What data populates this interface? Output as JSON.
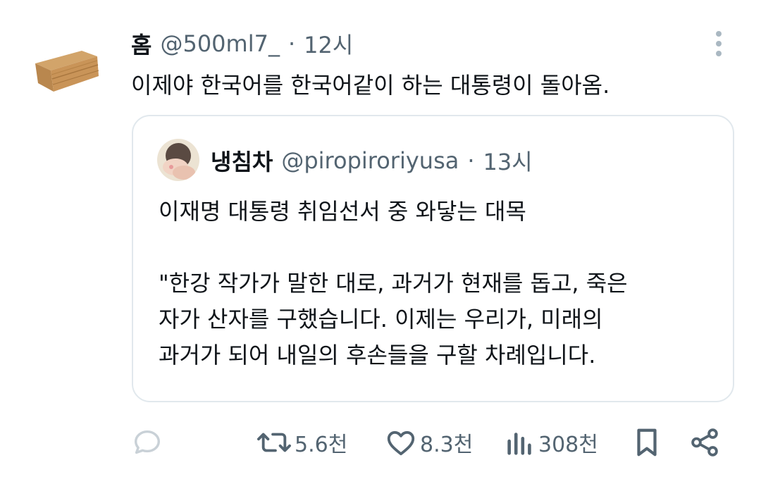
{
  "tweet": {
    "author_name": "홈",
    "handle": "@500ml7_",
    "separator": "·",
    "time": "12시",
    "text": "이제야 한국어를 한국어같이 하는 대통령이 돌아옴."
  },
  "quote": {
    "author_name": "냉침차",
    "handle": "@piropiroriyusa",
    "separator": "·",
    "time": "13시",
    "text": "이재명 대통령 취임선서 중 와닿는 대목\n\n\"한강 작가가 말한 대로, 과거가 현재를 돕고, 죽은\n자가 산자를 구했습니다. 이제는 우리가, 미래의\n과거가 되어 내일의 후손들을 구할 차례입니다."
  },
  "actions": {
    "retweets": "5.6천",
    "likes": "8.3천",
    "views": "308천"
  },
  "icons": {
    "reply": "reply-icon",
    "retweet": "retweet-icon",
    "like": "heart-icon",
    "views": "views-icon",
    "bookmark": "bookmark-icon",
    "share": "share-icon",
    "more": "more-vertical-icon"
  },
  "colors": {
    "text": "#0f1419",
    "secondary": "#536471",
    "border": "#e1e8ed"
  }
}
